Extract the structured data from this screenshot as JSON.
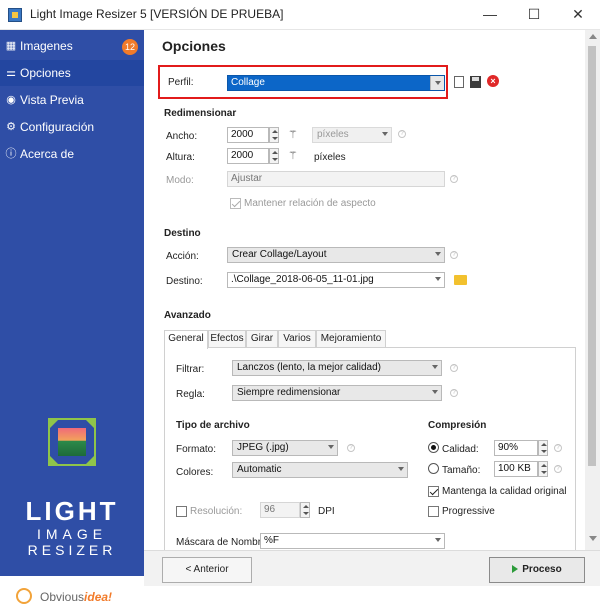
{
  "window": {
    "title": "Light Image Resizer 5  [VERSIÓN DE PRUEBA]",
    "minimize": "—",
    "maximize": "☐",
    "close": "✕"
  },
  "sidebar": {
    "items": [
      {
        "label": "Imagenes",
        "icon": "images-icon",
        "glyph": "▦",
        "badge": "12"
      },
      {
        "label": "Opciones",
        "icon": "sliders-icon",
        "glyph": "⚌"
      },
      {
        "label": "Vista Previa",
        "icon": "eye-icon",
        "glyph": "◉"
      },
      {
        "label": "Configuración",
        "icon": "gear-icon",
        "glyph": "⚙"
      },
      {
        "label": "Acerca de",
        "icon": "info-icon",
        "glyph": "ⓘ"
      }
    ],
    "logo": {
      "line1": "LIGHT",
      "line2": "IMAGE",
      "line3": "RESIZER"
    },
    "brand": {
      "prefix": "Obvious",
      "suffix": "idea!"
    }
  },
  "main": {
    "title": "Opciones",
    "profile": {
      "label": "Perfil:",
      "value": "Collage"
    },
    "resize": {
      "heading": "Redimensionar",
      "width_label": "Ancho:",
      "width_value": "2000",
      "height_label": "Altura:",
      "height_value": "2000",
      "unit_select": "píxeles",
      "unit_label": "píxeles",
      "mode_label": "Modo:",
      "mode_value": "Ajustar",
      "keep_aspect": "Mantener relación de aspecto"
    },
    "destination": {
      "heading": "Destino",
      "action_label": "Acción:",
      "action_value": "Crear Collage/Layout",
      "dest_label": "Destino:",
      "dest_value": ".\\Collage_2018-06-05_11-01.jpg"
    },
    "advanced": {
      "heading": "Avanzado",
      "tabs": [
        "General",
        "Efectos",
        "Girar",
        "Varios",
        "Mejoramiento"
      ],
      "filter_label": "Filtrar:",
      "filter_value": "Lanczos  (lento, la mejor calidad)",
      "rule_label": "Regla:",
      "rule_value": "Siempre redimensionar",
      "filetype_heading": "Tipo de archivo",
      "format_label": "Formato:",
      "format_value": "JPEG (.jpg)",
      "colors_label": "Colores:",
      "colors_value": "Automatic",
      "resolution_label": "Resolución:",
      "resolution_value": "96",
      "dpi_label": "DPI",
      "mask_label": "Máscara de Nombre",
      "mask_value": "%F",
      "compression_heading": "Compresión",
      "quality_label": "Calidad:",
      "quality_value": "90%",
      "size_label": "Tamaño:",
      "size_value": "100 KB",
      "keep_quality": "Mantenga la calidad original",
      "progressive": "Progressive"
    }
  },
  "footer": {
    "prev": "< Anterior",
    "next": "Proceso"
  }
}
